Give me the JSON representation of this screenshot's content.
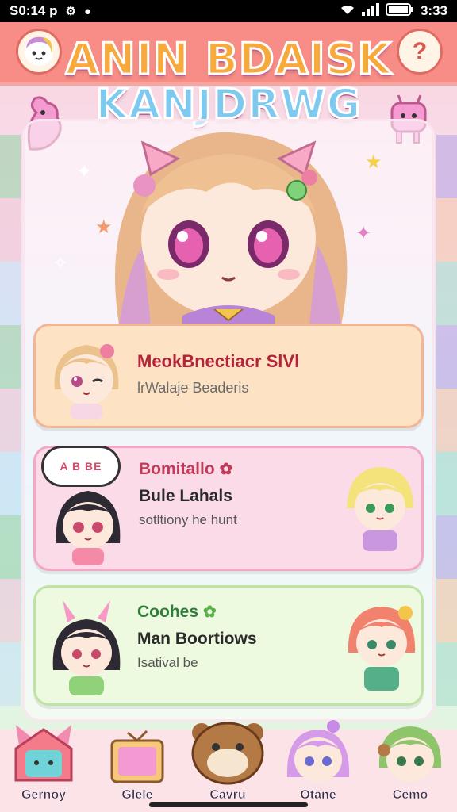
{
  "status_bar": {
    "time_left": "S0:14 p",
    "time_right": "3:33",
    "icons": [
      "wifi-icon",
      "signal-icon",
      "battery-icon"
    ]
  },
  "title": {
    "line1": "ANIN BDAISK",
    "line2": "KANJDRWG"
  },
  "cards": [
    {
      "title": "MeokBnectiacr SlVl",
      "subtitle": "",
      "description": "lrWalaje Beaderis"
    },
    {
      "title": "Bomitallo",
      "subtitle": "Bule Lahals",
      "description": "sotltiony he hunt",
      "speech_text": "A B BE"
    },
    {
      "title": "Coohes",
      "subtitle": "Man Boortiows",
      "description": "Isatival be"
    }
  ],
  "bottom_nav": [
    {
      "label": "Gernoy",
      "icon": "fox-house-icon"
    },
    {
      "label": "Glele",
      "icon": "tv-icon"
    },
    {
      "label": "Cavru",
      "icon": "bear-icon"
    },
    {
      "label": "Otane",
      "icon": "girl-avatar-icon"
    },
    {
      "label": "Cemo",
      "icon": "boy-avatar-icon"
    }
  ],
  "colors": {
    "header": "#f78d86",
    "card1": "#fde3c4",
    "card2": "#fbdbe8",
    "card3": "#eefae0",
    "accent_red": "#b3243b"
  }
}
